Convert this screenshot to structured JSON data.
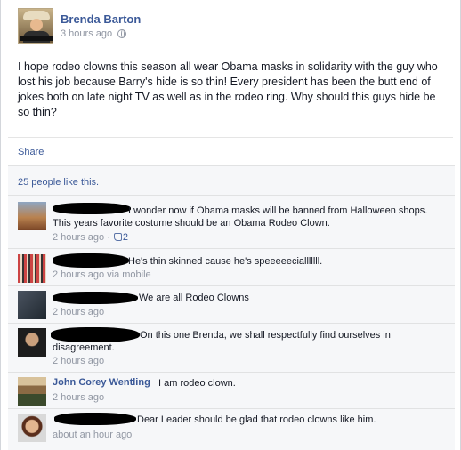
{
  "post": {
    "author": "Brenda Barton",
    "timestamp": "3 hours ago",
    "text": "I hope rodeo clowns this season all wear Obama masks in solidarity with the guy who lost his job because Barry's hide is so thin! Every president has been the butt end of jokes both on late night TV as well as in the rodeo ring. Why should this guys hide be so thin?",
    "share_label": "Share",
    "likes_text": "25 people like this."
  },
  "comments": [
    {
      "text": "I wonder now if Obama masks will be banned from Halloween shops. This years favorite costume should be an Obama Rodeo Clown.",
      "time": "2 hours ago",
      "separator": "·",
      "like_count": "2"
    },
    {
      "text": "He's thin skinned cause he's speeeeecialllllll.",
      "time": "2 hours ago via mobile"
    },
    {
      "text": "We are all Rodeo Clowns",
      "time": "2 hours ago"
    },
    {
      "text": "On this one Brenda, we shall respectfully find ourselves in disagreement.",
      "time": "2 hours ago"
    },
    {
      "name": "John Corey Wentling",
      "text": "I am rodeo clown.",
      "time": "2 hours ago"
    },
    {
      "text": "Dear Leader should be glad that rodeo clowns like him.",
      "time": "about an hour ago"
    }
  ],
  "colors": {
    "link": "#3b5998",
    "meta": "#9197a3",
    "comment_bg": "#f6f7f9"
  }
}
